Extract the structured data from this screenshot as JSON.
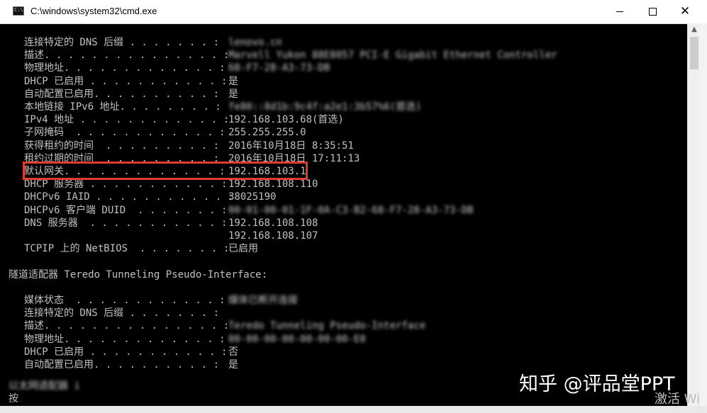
{
  "window": {
    "title": "C:\\windows\\system32\\cmd.exe",
    "minimize_glyph": "",
    "maximize_glyph": "",
    "close_glyph": "✕"
  },
  "console": {
    "lines": [
      {
        "label": "连接特定的 DNS 后缀 . . . . . . . :",
        "value": "lenovo.cn",
        "blurred": true
      },
      {
        "label": "描述. . . . . . . . . . . . . . . :",
        "value": "Marvell Yukon 88E8057 PCI-E Gigabit Ethernet Controller",
        "blurred": true
      },
      {
        "label": "物理地址. . . . . . . . . . . . . :",
        "value": "68-F7-28-A3-73-DB",
        "blurred": true
      },
      {
        "label": "DHCP 已启用 . . . . . . . . . . . :",
        "value": "是",
        "blurred": false
      },
      {
        "label": "自动配置已启用. . . . . . . . . . :",
        "value": "是",
        "blurred": false
      },
      {
        "label": "本地链接 IPv6 地址. . . . . . . . :",
        "value": "fe80::8d1b:9c4f:a2e1:3b57%6(首选)",
        "blurred": true
      },
      {
        "label": "IPv4 地址 . . . . . . . . . . . . :",
        "value": "192.168.103.68(首选)",
        "blurred": false
      },
      {
        "label": "子网掩码  . . . . . . . . . . . . :",
        "value": "255.255.255.0",
        "blurred": false
      },
      {
        "label": "获得租约的时间  . . . . . . . . . :",
        "value": "2016年10月18日 8:35:51",
        "blurred": false
      },
      {
        "label": "租约过期的时间  . . . . . . . . . :",
        "value": "2016年10月18日 17:11:13",
        "blurred": false
      },
      {
        "label": "默认网关. . . . . . . . . . . . . :",
        "value": "192.168.103.1",
        "blurred": false
      },
      {
        "label": "DHCP 服务器 . . . . . . . . . . . :",
        "value": "192.168.108.110",
        "blurred": false
      },
      {
        "label": "DHCPv6 IAID . . . . . . . . . . . :",
        "value": "38025190",
        "blurred": false
      },
      {
        "label": "DHCPv6 客户端 DUID  . . . . . . . :",
        "value": "00-01-00-01-1F-0A-C3-B2-68-F7-28-A3-73-DB",
        "blurred": true
      },
      {
        "label": "DNS 服务器  . . . . . . . . . . . :",
        "value": "192.168.108.108",
        "blurred": false
      },
      {
        "label": "",
        "value": "192.168.108.107",
        "blurred": false
      },
      {
        "label": "TCPIP 上的 NetBIOS  . . . . . . . :",
        "value": "已启用",
        "blurred": false
      },
      {
        "label": "",
        "value": "",
        "blurred": false
      },
      {
        "label": "隧道适配器 Teredo Tunneling Pseudo-Interface:",
        "value": "",
        "blurred": false,
        "indent": false
      },
      {
        "label": "",
        "value": "",
        "blurred": false
      },
      {
        "label": "媒体状态  . . . . . . . . . . . . :",
        "value": "媒体已断开连接",
        "blurred": true
      },
      {
        "label": "连接特定的 DNS 后缀 . . . . . . . :",
        "value": "",
        "blurred": false
      },
      {
        "label": "描述. . . . . . . . . . . . . . . :",
        "value": "Teredo Tunneling Pseudo-Interface",
        "blurred": true
      },
      {
        "label": "物理地址. . . . . . . . . . . . . :",
        "value": "00-00-00-00-00-00-00-E0",
        "blurred": true
      },
      {
        "label": "DHCP 已启用 . . . . . . . . . . . :",
        "value": "否",
        "blurred": false
      },
      {
        "label": "自动配置已启用. . . . . . . . . . :",
        "value": "是",
        "blurred": false
      }
    ],
    "footer_fragment_1": "以太网适配器 i",
    "footer_fragment_2": "按"
  },
  "overlay": {
    "watermark": "知乎 @评品堂PPT",
    "activate_text": "激活 Wi"
  },
  "colors": {
    "console_text": "#c0c0c0",
    "console_bg": "#000000",
    "highlight_border": "#e03a33"
  }
}
